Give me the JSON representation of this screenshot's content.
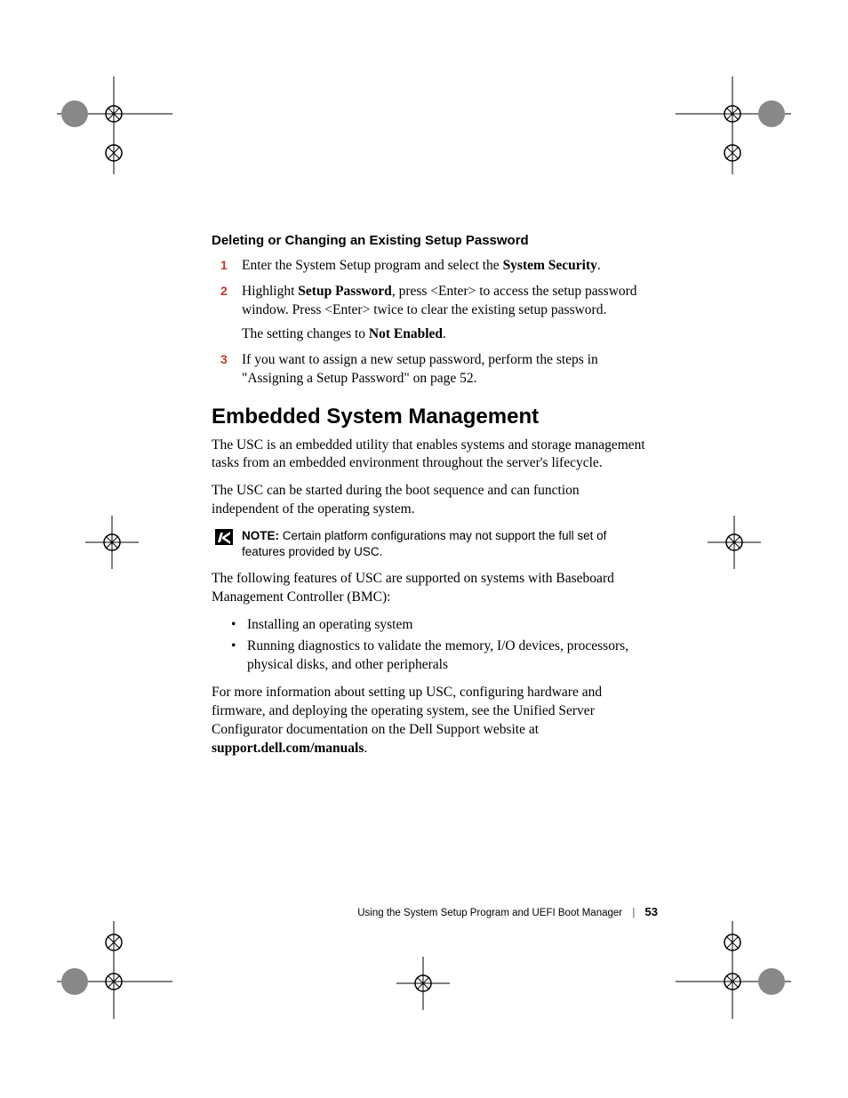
{
  "section": {
    "heading": "Deleting or Changing an Existing Setup Password",
    "steps": [
      {
        "num": "1",
        "paragraphs": [
          {
            "segments": [
              {
                "t": "Enter the System Setup program and select the "
              },
              {
                "t": "System Security",
                "b": true
              },
              {
                "t": "."
              }
            ]
          }
        ]
      },
      {
        "num": "2",
        "paragraphs": [
          {
            "segments": [
              {
                "t": "Highlight "
              },
              {
                "t": "Setup Password",
                "b": true
              },
              {
                "t": ", press <Enter> to access the setup password window. Press <Enter> twice to clear the existing setup password."
              }
            ]
          },
          {
            "segments": [
              {
                "t": "The setting changes to "
              },
              {
                "t": "Not Enabled",
                "b": true
              },
              {
                "t": "."
              }
            ]
          }
        ]
      },
      {
        "num": "3",
        "paragraphs": [
          {
            "segments": [
              {
                "t": "If you want to assign a new setup password, perform the steps in \"Assigning a Setup Password\" on page 52."
              }
            ]
          }
        ]
      }
    ]
  },
  "main": {
    "heading": "Embedded System Management",
    "paras_before_note": [
      "The USC is an embedded utility that enables systems and storage management tasks from an embedded environment throughout the server's lifecycle.",
      "The USC can be started during the boot sequence and can function independent of the operating system."
    ],
    "note": {
      "label": "NOTE:",
      "text": " Certain platform configurations may not support the full set of features provided by USC."
    },
    "para_after_note": "The following features of USC are supported on systems with Baseboard Management Controller (BMC):",
    "bullets": [
      "Installing an operating system",
      "Running diagnostics to validate the memory, I/O devices, processors, physical disks, and other peripherals"
    ],
    "closing": {
      "segments": [
        {
          "t": "For more information about setting up USC, configuring hardware and firmware, and deploying the operating system, see the Unified Server Configurator documentation on the Dell Support website at "
        },
        {
          "t": "support.dell.com/manuals",
          "b": true
        },
        {
          "t": "."
        }
      ]
    }
  },
  "footer": {
    "chapter": "Using the System Setup Program and UEFI Boot Manager",
    "page": "53"
  }
}
